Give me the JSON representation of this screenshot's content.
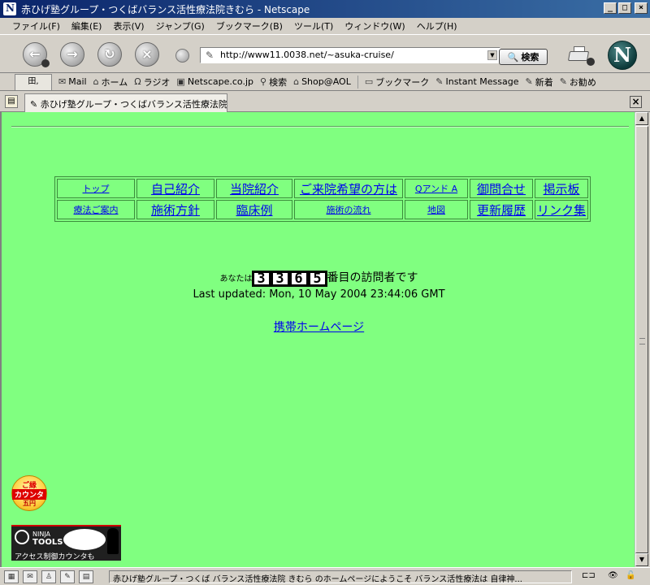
{
  "window": {
    "title": "赤ひげ塾グループ・つくばバランス活性療法院きむら - Netscape",
    "min": "_",
    "max": "□",
    "close": "×"
  },
  "menu": [
    "ファイル(F)",
    "編集(E)",
    "表示(V)",
    "ジャンプ(G)",
    "ブックマーク(B)",
    "ツール(T)",
    "ウィンドウ(W)",
    "ヘルプ(H)"
  ],
  "nav": {
    "url": "http://www11.0038.net/~asuka-cruise/",
    "search_label": "検索",
    "logo_letter": "N"
  },
  "personal_toolbar": {
    "items": [
      "Mail",
      "ホーム",
      "ラジオ",
      "Netscape.co.jp",
      "検索",
      "Shop@AOL",
      "ブックマーク",
      "Instant Message",
      "新着",
      "お勧め"
    ]
  },
  "tabs": [
    {
      "label": "赤ひげ塾グループ・つくばバランス活性療法院..."
    }
  ],
  "page": {
    "nav_rows": [
      [
        "トップ",
        "自己紹介",
        "当院紹介",
        "ご来院希望の方は",
        "Qアンド A",
        "御問合せ",
        "掲示板"
      ],
      [
        "療法ご案内",
        "施術方針",
        "臨床例",
        "施術の流れ",
        "地図",
        "更新履歴",
        "リンク集"
      ]
    ],
    "counter_prefix": "あなたは",
    "counter_digits": [
      "3",
      "3",
      "6",
      "5"
    ],
    "counter_suffix": "番目の訪問者です",
    "last_updated": "Last updated: Mon, 10 May 2004 23:44:06 GMT",
    "mobile_link": "携帯ホームページ",
    "badge": {
      "line1": "ご縁",
      "line2": "カウンタ",
      "line3": "五円"
    },
    "banner": {
      "line1": "NINJA",
      "line2": "TOOLS",
      "line3": "アクセス制御カウンタも"
    }
  },
  "status": {
    "text": "赤ひげ塾グループ・つくば バランス活性療法院 きむら のホームページにようこそ バランス活性療法は 自律神..."
  },
  "colors": {
    "page_bg": "#80ff80",
    "link": "#0000ee",
    "titlebar": "#0a246a"
  }
}
